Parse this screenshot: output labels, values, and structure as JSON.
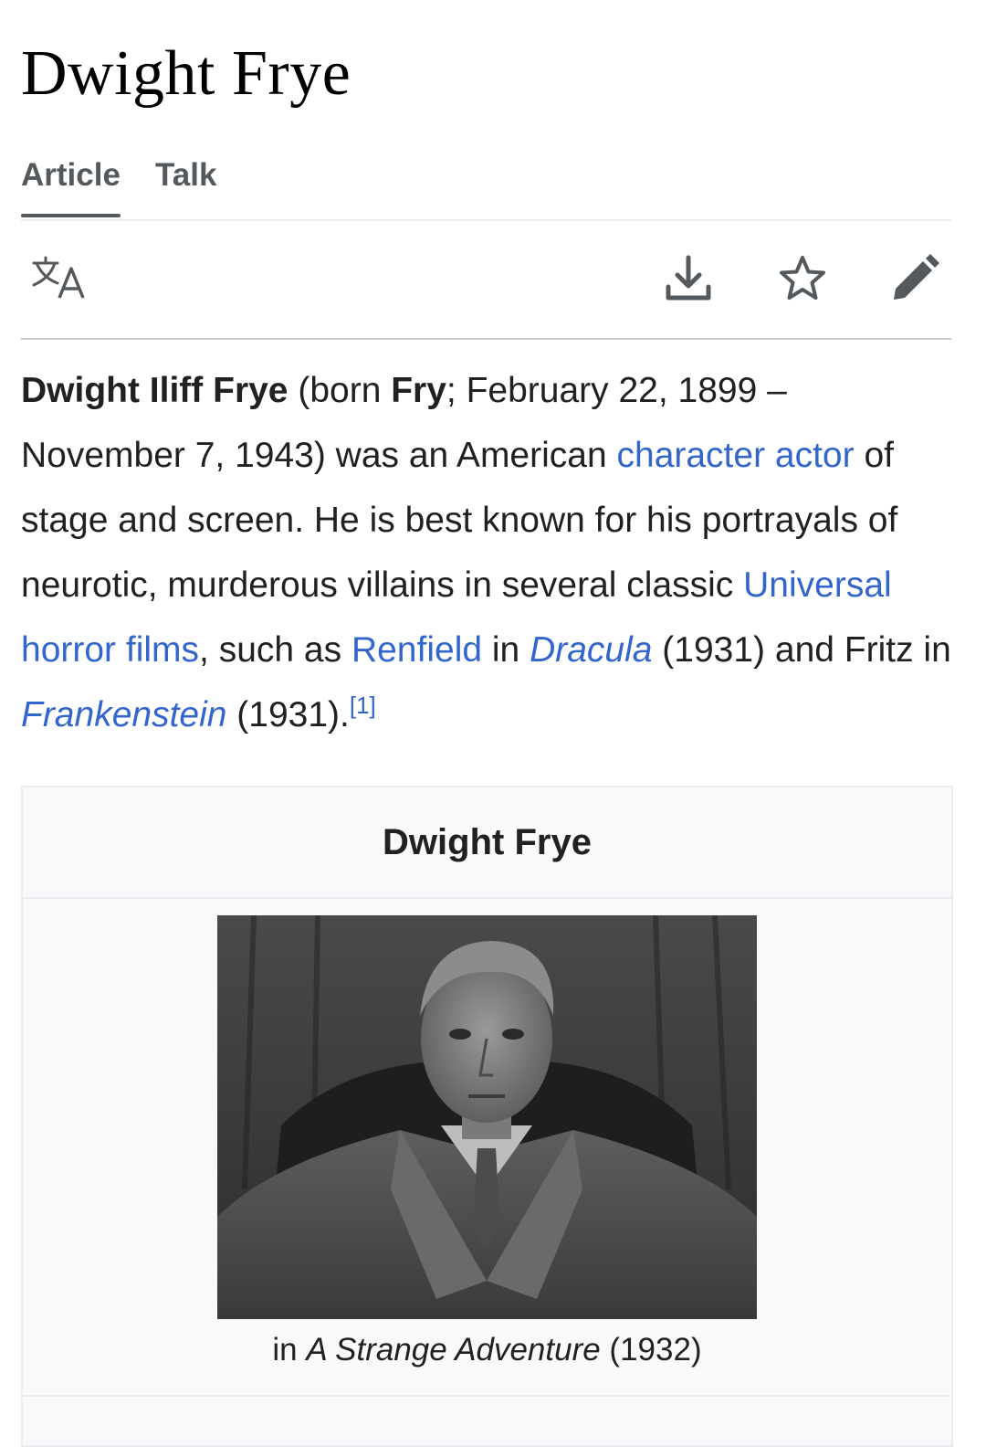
{
  "page": {
    "title": "Dwight Frye"
  },
  "tabs": [
    {
      "label": "Article",
      "active": true
    },
    {
      "label": "Talk",
      "active": false
    }
  ],
  "toolbar": {
    "icons": [
      "language-icon",
      "download-icon",
      "star-icon",
      "edit-pencil-icon"
    ]
  },
  "lead": {
    "name_bold": "Dwight Iliff Frye",
    "t1": " (born ",
    "born_bold": "Fry",
    "t2": "; February 22, 1899 – November 7, 1943) was an American ",
    "link_character_actor": "character actor",
    "t3": " of stage and screen. He is best known for his portrayals of neurotic, murderous villains in several classic ",
    "link_universal": "Universal horror films",
    "t4": ", such as ",
    "link_renfield": "Renfield",
    "t5": " in ",
    "link_dracula": "Dracula",
    "t6": " (1931) and Fritz in ",
    "link_frankenstein": "Frankenstein",
    "t7": " (1931).",
    "ref": "[1]"
  },
  "infobox": {
    "title": "Dwight Frye",
    "caption_prefix": "in ",
    "caption_title": "A Strange Adventure",
    "caption_suffix": " (1932)"
  },
  "colors": {
    "link": "#3366cc",
    "text": "#202122",
    "border": "#eaecf0"
  }
}
